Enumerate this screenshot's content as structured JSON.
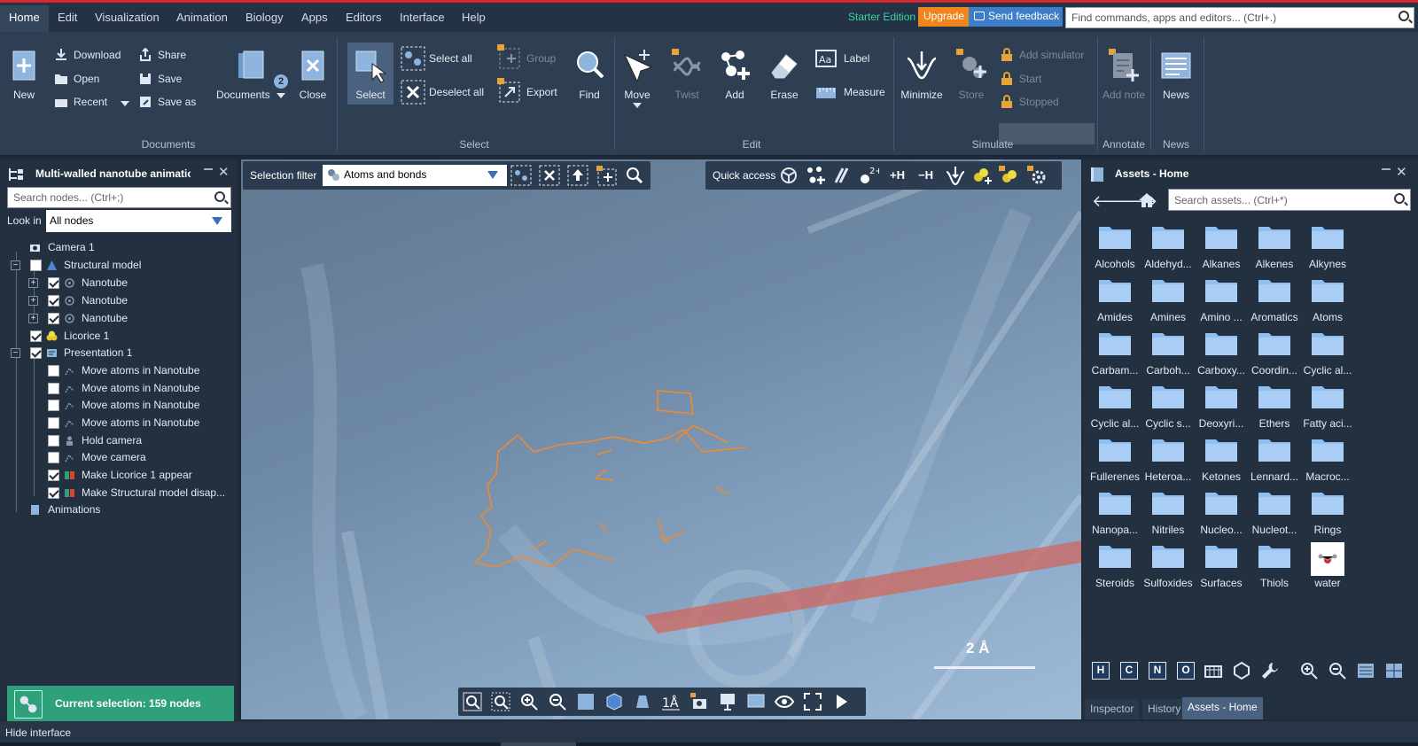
{
  "menu": {
    "items": [
      "Home",
      "Edit",
      "Visualization",
      "Animation",
      "Biology",
      "Apps",
      "Editors",
      "Interface",
      "Help"
    ],
    "edition": "Starter Edition",
    "upgrade": "Upgrade",
    "feedback": "Send feedback",
    "search_placeholder": "Find commands, apps and editors... (Ctrl+.)"
  },
  "ribbon": {
    "documents": {
      "label": "Documents",
      "new": "New",
      "download": "Download",
      "open": "Open",
      "recent": "Recent",
      "share": "Share",
      "save": "Save",
      "save_as": "Save as",
      "documents_btn": "Documents",
      "badge": "2",
      "close": "Close"
    },
    "select": {
      "label": "Select",
      "select": "Select",
      "select_all": "Select all",
      "deselect_all": "Deselect all",
      "group": "Group",
      "export": "Export",
      "find": "Find"
    },
    "edit": {
      "label": "Edit",
      "move": "Move",
      "twist": "Twist",
      "add": "Add",
      "erase": "Erase",
      "label_btn": "Label",
      "measure": "Measure"
    },
    "simulate": {
      "label": "Simulate",
      "minimize": "Minimize",
      "store": "Store",
      "add_simulator": "Add simulator",
      "start": "Start",
      "stopped": "Stopped"
    },
    "annotate": {
      "label": "Annotate",
      "add_note": "Add note"
    },
    "news": {
      "label": "News",
      "news": "News"
    }
  },
  "left_panel": {
    "title": "Multi-walled nanotube animation",
    "search_placeholder": "Search nodes... (Ctrl+;)",
    "look_in_label": "Look in",
    "look_in_value": "All nodes",
    "tree": [
      {
        "label": "Camera 1"
      },
      {
        "label": "Structural model"
      },
      {
        "label": "Nanotube"
      },
      {
        "label": "Nanotube"
      },
      {
        "label": "Nanotube"
      },
      {
        "label": "Licorice 1"
      },
      {
        "label": "Presentation 1"
      },
      {
        "label": "Move atoms in Nanotube"
      },
      {
        "label": "Move atoms in Nanotube"
      },
      {
        "label": "Move atoms in Nanotube"
      },
      {
        "label": "Move atoms in Nanotube"
      },
      {
        "label": "Hold camera"
      },
      {
        "label": "Move camera"
      },
      {
        "label": "Make Licorice 1 appear"
      },
      {
        "label": "Make Structural model disap..."
      },
      {
        "label": "Animations"
      }
    ],
    "current_selection": "Current selection: 159 nodes"
  },
  "viewport": {
    "selection_filter_label": "Selection filter",
    "selection_filter_value": "Atoms and bonds",
    "quick_access_label": "Quick access",
    "plus_h": "+H",
    "minus_h": "−H",
    "scale_label": "2 Å"
  },
  "right_panel": {
    "title": "Assets - Home",
    "search_placeholder": "Search assets... (Ctrl+*)",
    "assets": [
      "Alcohols",
      "Aldehyd...",
      "Alkanes",
      "Alkenes",
      "Alkynes",
      "Amides",
      "Amines",
      "Amino ...",
      "Aromatics",
      "Atoms",
      "Carbam...",
      "Carboh...",
      "Carboxy...",
      "Coordin...",
      "Cyclic al...",
      "Cyclic al...",
      "Cyclic s...",
      "Deoxyri...",
      "Ethers",
      "Fatty aci...",
      "Fullerenes",
      "Heteroa...",
      "Ketones",
      "Lennard...",
      "Macroc...",
      "Nanopa...",
      "Nitriles",
      "Nucleo...",
      "Nucleot...",
      "Rings",
      "Steroids",
      "Sulfoxides",
      "Surfaces",
      "Thiols",
      "water"
    ],
    "element_buttons": [
      "H",
      "C",
      "N",
      "O"
    ],
    "tabs": [
      "Inspector",
      "History",
      "Assets - Home"
    ]
  },
  "status": {
    "text": "Hide interface"
  }
}
